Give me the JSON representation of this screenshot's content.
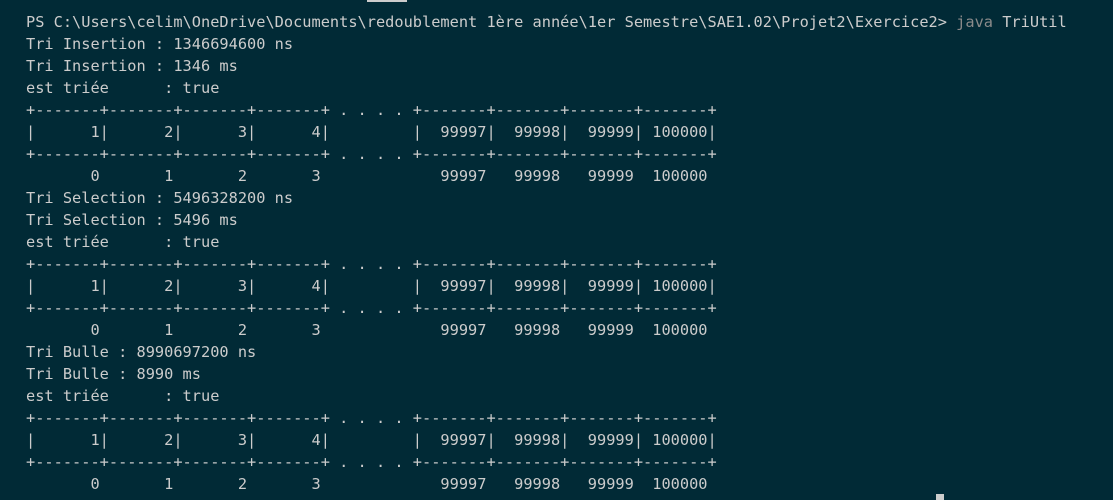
{
  "terminal": {
    "prompt": "PS C:\\Users\\celim\\OneDrive\\Documents\\redoublement 1ère année\\1er Semestre\\SAE1.02\\Projet2\\Exercice2> ",
    "command": "java",
    "argument": " TriUtil",
    "output_lines": [
      "Tri Insertion : 1346694600 ns",
      "Tri Insertion : 1346 ms",
      "est triée      : true",
      "+-------+-------+-------+-------+ . . . . +-------+-------+-------+-------+",
      "|      1|      2|      3|      4|         |  99997|  99998|  99999| 100000|",
      "+-------+-------+-------+-------+ . . . . +-------+-------+-------+-------+",
      "       0       1       2       3             99997   99998   99999  100000",
      "Tri Selection : 5496328200 ns",
      "Tri Selection : 5496 ms",
      "est triée      : true",
      "+-------+-------+-------+-------+ . . . . +-------+-------+-------+-------+",
      "|      1|      2|      3|      4|         |  99997|  99998|  99999| 100000|",
      "+-------+-------+-------+-------+ . . . . +-------+-------+-------+-------+",
      "       0       1       2       3             99997   99998   99999  100000",
      "Tri Bulle : 8990697200 ns",
      "Tri Bulle : 8990 ms",
      "est triée      : true",
      "+-------+-------+-------+-------+ . . . . +-------+-------+-------+-------+",
      "|      1|      2|      3|      4|         |  99997|  99998|  99999| 100000|",
      "+-------+-------+-------+-------+ . . . . +-------+-------+-------+-------+",
      "       0       1       2       3             99997   99998   99999  100000"
    ]
  },
  "colors": {
    "background": "#012a36",
    "text": "#cccccc",
    "command": "#8a8a8a"
  }
}
